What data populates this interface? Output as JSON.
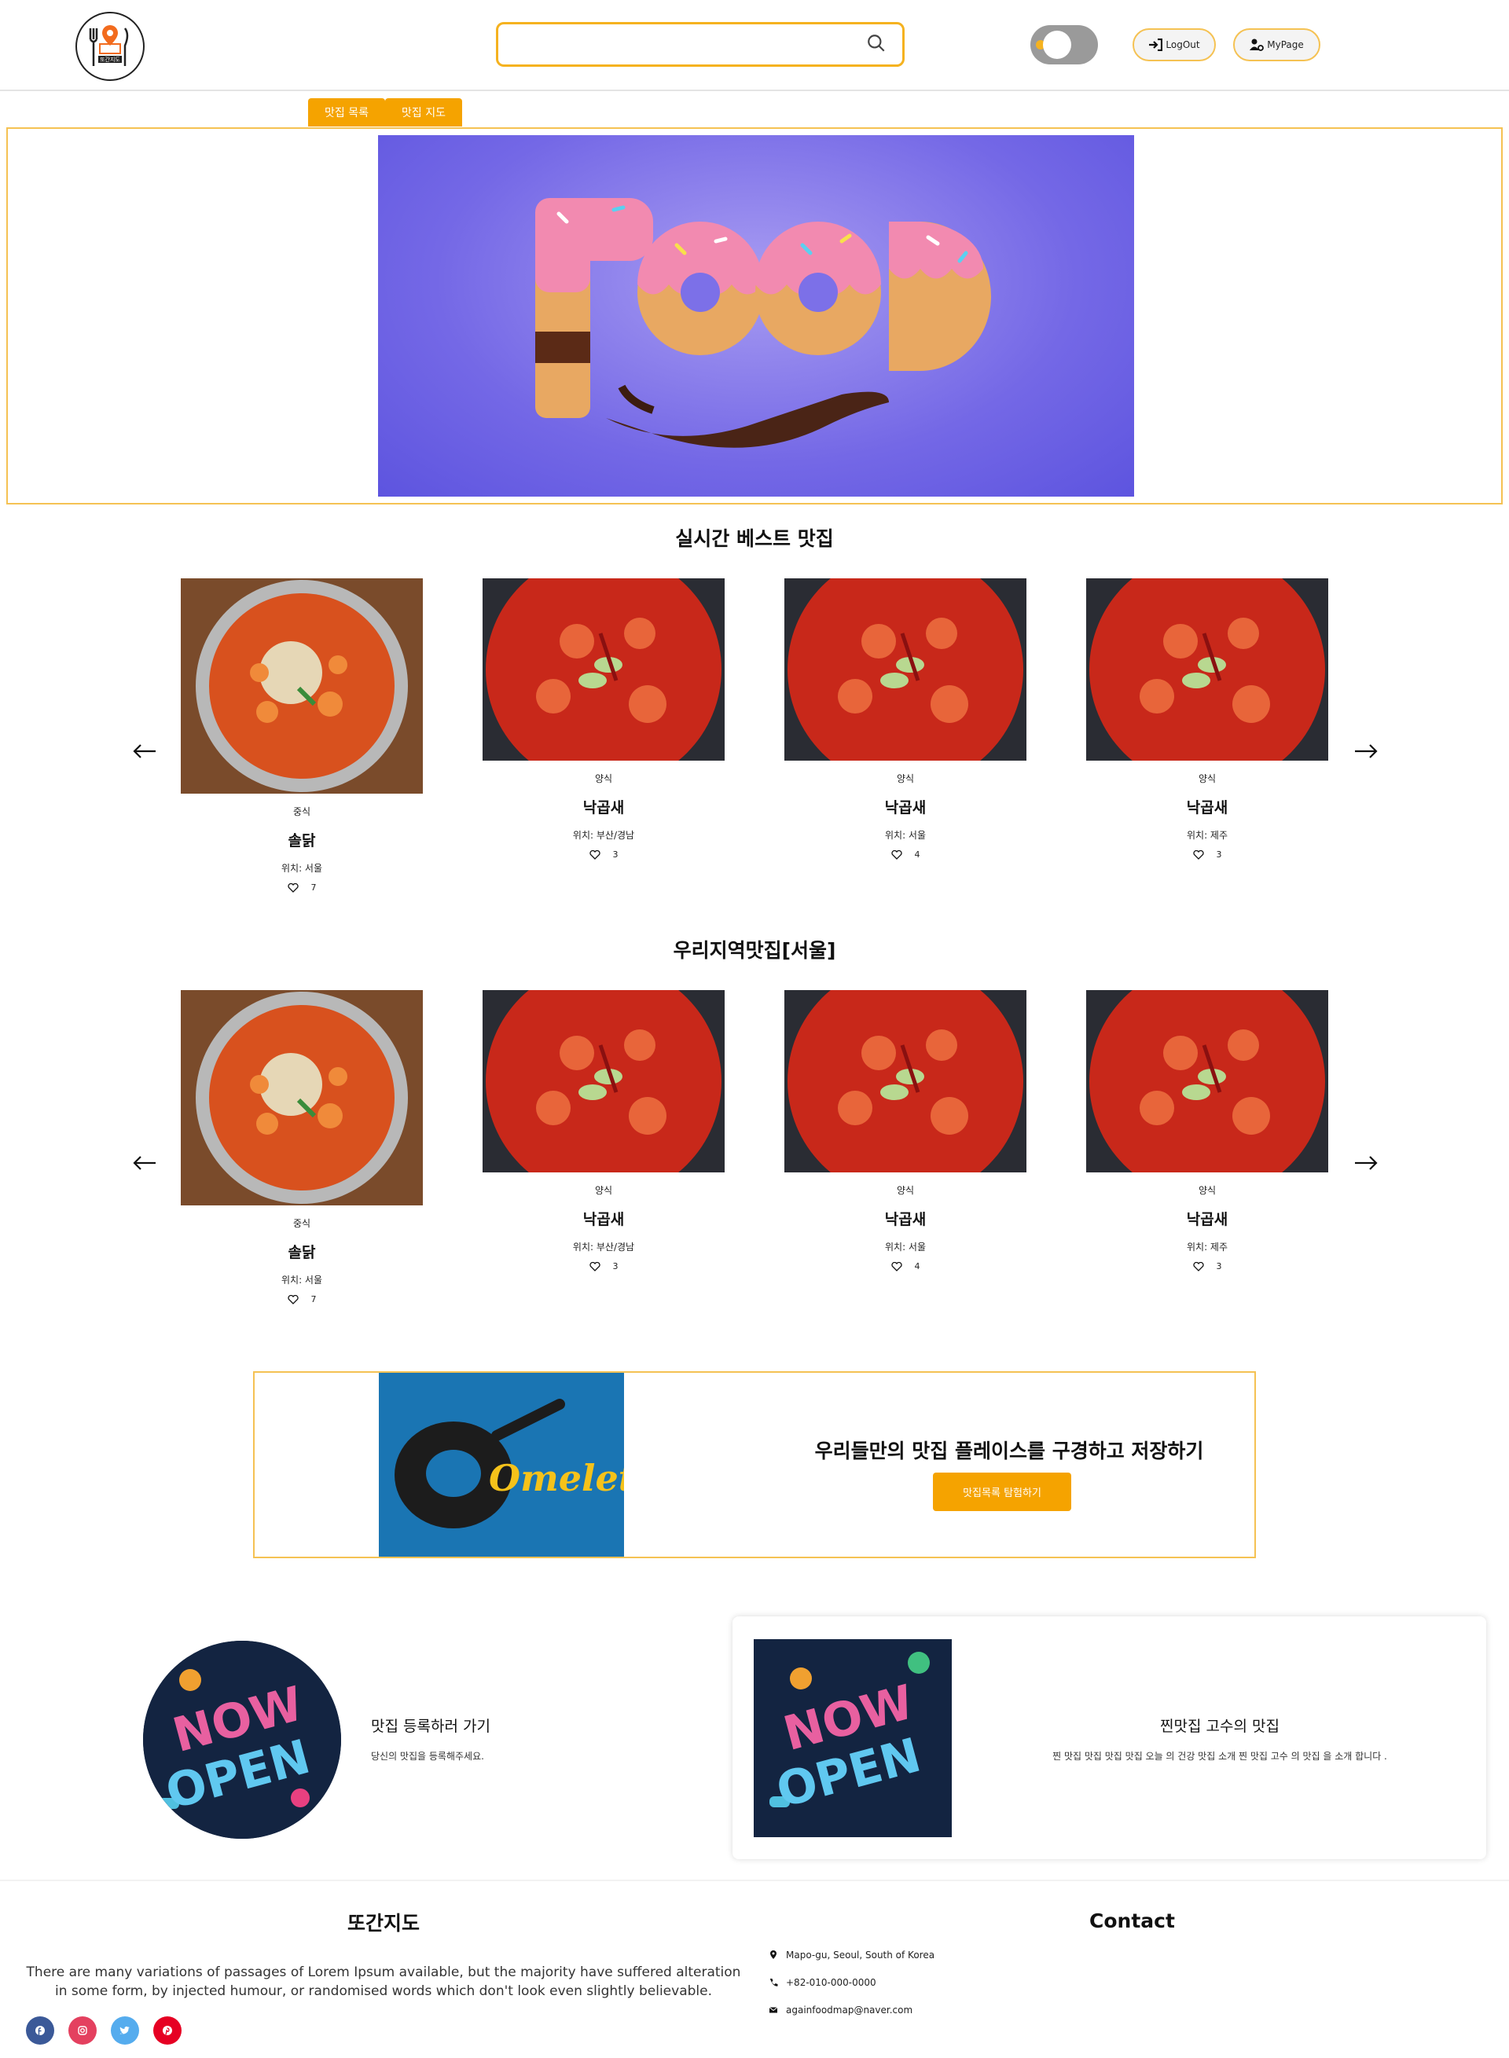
{
  "header": {
    "logo_text": "또간지도",
    "search_placeholder": "",
    "logout_label": "LogOut",
    "mypage_label": "MyPage"
  },
  "tabs": [
    {
      "label": "맛집 목록"
    },
    {
      "label": "맛집 지도"
    }
  ],
  "banner": {
    "image_text": "FOOD"
  },
  "best_section": {
    "title": "실시간 베스트 맛집",
    "cards": [
      {
        "category": "중식",
        "name": "솔닭",
        "location": "위치: 서울",
        "likes": "7"
      },
      {
        "category": "양식",
        "name": "낙곱새",
        "location": "위치: 부산/경남",
        "likes": "3"
      },
      {
        "category": "양식",
        "name": "낙곱새",
        "location": "위치: 서울",
        "likes": "4"
      },
      {
        "category": "양식",
        "name": "낙곱새",
        "location": "위치: 제주",
        "likes": "3"
      }
    ]
  },
  "local_section": {
    "title": "우리지역맛집[서울]",
    "cards": [
      {
        "category": "중식",
        "name": "솔닭",
        "location": "위치: 서울",
        "likes": "7"
      },
      {
        "category": "양식",
        "name": "낙곱새",
        "location": "위치: 부산/경남",
        "likes": "3"
      },
      {
        "category": "양식",
        "name": "낙곱새",
        "location": "위치: 서울",
        "likes": "4"
      },
      {
        "category": "양식",
        "name": "낙곱새",
        "location": "위치: 제주",
        "likes": "3"
      }
    ]
  },
  "promo": {
    "image_text": "Omelette",
    "title": "우리들만의 맛집 플레이스를 구경하고 저장하기",
    "button_label": "맛집목록 탐험하기"
  },
  "features": [
    {
      "title": "맛집 등록하러 가기",
      "desc": "당신의 맛집을 등록해주세요.",
      "image_text": "NOW OPEN"
    },
    {
      "title": "찐맛집 고수의 맛집",
      "desc": "찐 맛집 맛집 맛집 맛집 오늘 의 건강 맛집 소개 찐 맛집 고수 의 맛집 을 소개 합니다 .",
      "image_text": "NOW OPEN"
    }
  ],
  "footer": {
    "brand": "또간지도",
    "description": "There are many variations of passages of Lorem Ipsum available, but the majority have suffered alteration in some form, by injected humour, or randomised words which don't look even slightly believable.",
    "contact_title": "Contact",
    "address": "Mapo-gu, Seoul, South of Korea",
    "phone": "+82-010-000-0000",
    "email": "againfoodmap@naver.com",
    "social": [
      {
        "icon": "facebook-icon",
        "color": "#3b5998"
      },
      {
        "icon": "instagram-icon",
        "color": "#e4405f"
      },
      {
        "icon": "twitter-icon",
        "color": "#55acee"
      },
      {
        "icon": "pinterest-icon",
        "color": "#e60023"
      }
    ]
  },
  "colors": {
    "accent": "#f5a300",
    "border": "#f5c253"
  }
}
